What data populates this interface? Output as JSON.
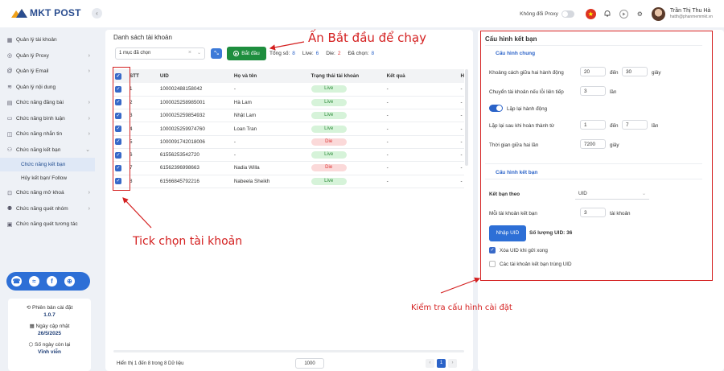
{
  "app": {
    "logo_text": "MKT POST"
  },
  "topbar": {
    "proxy_label": "Không đổi Proxy",
    "user_name": "Trần Thị Thu Hà",
    "user_email": "hatth@phanmemmkt.vn"
  },
  "sidebar": {
    "items": [
      {
        "label": "Quản lý tài khoản",
        "icon": "grid-icon",
        "chevron": false
      },
      {
        "label": "Quản lý Proxy",
        "icon": "globe-icon",
        "chevron": true
      },
      {
        "label": "Quản lý Email",
        "icon": "at-icon",
        "chevron": true
      },
      {
        "label": "Quản lý nội dung",
        "icon": "content-icon",
        "chevron": false
      },
      {
        "label": "Chức năng đăng bài",
        "icon": "post-icon",
        "chevron": true
      },
      {
        "label": "Chức năng bình luận",
        "icon": "comment-icon",
        "chevron": true
      },
      {
        "label": "Chức năng nhắn tin",
        "icon": "message-icon",
        "chevron": true
      },
      {
        "label": "Chức năng kết bạn",
        "icon": "add-friend-icon",
        "chevron": true
      }
    ],
    "subitems": [
      {
        "label": "Chức năng kết bạn",
        "active": true
      },
      {
        "label": "Hủy kết bạn/ Follow",
        "active": false
      }
    ],
    "items_after": [
      {
        "label": "Chức năng mở khoá",
        "icon": "lock-icon",
        "chevron": true
      },
      {
        "label": "Chức năng quét nhóm",
        "icon": "group-icon",
        "chevron": true
      },
      {
        "label": "Chức năng quét tương tác",
        "icon": "scan-icon",
        "chevron": false
      }
    ],
    "info": {
      "version_label": "Phiên bản cài đặt",
      "version": "1.0.7",
      "update_label": "Ngày cập nhật",
      "update": "26/5/2025",
      "days_label": "Số ngày còn lại",
      "days": "Vĩnh viễn"
    }
  },
  "accounts": {
    "title": "Danh sách tài khoản",
    "select_value": "1 mục đã chọn",
    "start_label": "Bắt đầu",
    "stats": {
      "total_label": "Tổng số:",
      "total": "8",
      "live_label": "Live:",
      "live": "6",
      "die_label": "Die:",
      "die": "2",
      "selected_label": "Đã chọn:",
      "selected": "8"
    },
    "columns": [
      "STT",
      "UID",
      "Họ và tên",
      "Trạng thái tài khoản",
      "Kết quả",
      "H"
    ],
    "rows": [
      {
        "stt": "1",
        "uid": "100002488158042",
        "name": "-",
        "status": "Live",
        "result": "-",
        "h": "-"
      },
      {
        "stt": "2",
        "uid": "100002525898500​1",
        "name": "Hà Lam",
        "status": "Live",
        "result": "-",
        "h": "-"
      },
      {
        "stt": "3",
        "uid": "100002525985493​2",
        "name": "Nhật Lam",
        "status": "Live",
        "result": "-",
        "h": "-"
      },
      {
        "stt": "4",
        "uid": "100002525997476​0",
        "name": "Loan Tran",
        "status": "Live",
        "result": "-",
        "h": "-"
      },
      {
        "stt": "5",
        "uid": "100009174201800​6",
        "name": "-",
        "status": "Die",
        "result": "-",
        "h": "-"
      },
      {
        "stt": "6",
        "uid": "61556253542720",
        "name": "-",
        "status": "Live",
        "result": "-",
        "h": "-"
      },
      {
        "stt": "7",
        "uid": "61562396998663",
        "name": "Nadia Willa",
        "status": "Die",
        "result": "-",
        "h": "-"
      },
      {
        "stt": "8",
        "uid": "61566845792216",
        "name": "Nabeela Sheikh",
        "status": "Live",
        "result": "-",
        "h": "-"
      }
    ],
    "footer": "Hiển thị 1 đến 8 trong 8 Dữ liệu",
    "page_size": "1000",
    "current_page": "1"
  },
  "config": {
    "title": "Cấu hình kết bạn",
    "general_title": "Cấu hình chung",
    "interval_label": "Khoảng cách giữa hai hành động",
    "interval_from": "20",
    "to_label": "đến",
    "interval_to": "30",
    "sec_label": "giây",
    "switch_label": "Chuyển tài khoản nếu lỗi liên tiếp",
    "switch_value": "3",
    "times_label": "lần",
    "repeat_label": "Lặp lại hành động",
    "repeat_after_label": "Lặp lại sau khi hoàn thành từ",
    "repeat_from": "1",
    "repeat_to": "7",
    "between_label": "Thời gian giữa hai lần",
    "between_value": "7200",
    "friend_title": "Cấu hình kết bạn",
    "by_label": "Kết bạn theo",
    "by_value": "UID",
    "per_account_label": "Mỗi tài khoản kết bạn",
    "per_account_value": "3",
    "account_unit": "tài khoản",
    "import_label": "Nhập UID",
    "uid_count_label": "Số lượng UID: 36",
    "delete_label": "Xóa UID khi gửi xong",
    "dup_label": "Các tài khoản kết bạn trùng UID"
  },
  "annotations": {
    "start": "Ấn Bắt đầu để chạy",
    "tick": "Tick chọn tài khoản",
    "check": "Kiểm tra cấu hình cài đặt"
  },
  "colors": {
    "accent": "#2b63c8",
    "start_green": "#1e8e3e",
    "annotation_red": "#d42020"
  }
}
